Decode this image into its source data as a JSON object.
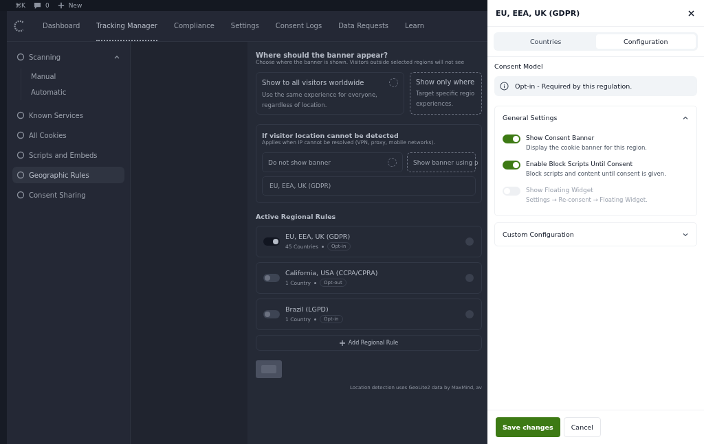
{
  "admin_bar": {
    "shortcut": "⌘K",
    "comments": "0",
    "new_label": "New"
  },
  "nav": {
    "tabs": [
      {
        "label": "Dashboard",
        "selected": false
      },
      {
        "label": "Tracking Manager",
        "selected": true
      },
      {
        "label": "Compliance",
        "selected": false
      },
      {
        "label": "Settings",
        "selected": false
      },
      {
        "label": "Consent Logs",
        "selected": false
      },
      {
        "label": "Data Requests",
        "selected": false
      },
      {
        "label": "Learn",
        "selected": false
      }
    ]
  },
  "sidebar": {
    "items": [
      {
        "label": "Scanning",
        "selected": false,
        "expanded": true,
        "children": [
          {
            "label": "Manual",
            "selected": false
          },
          {
            "label": "Automatic",
            "selected": false
          }
        ]
      },
      {
        "label": "Known Services",
        "selected": false
      },
      {
        "label": "All Cookies",
        "selected": false
      },
      {
        "label": "Scripts and Embeds",
        "selected": false
      },
      {
        "label": "Geographic Rules",
        "selected": true
      },
      {
        "label": "Consent Sharing",
        "selected": false
      }
    ]
  },
  "banner_placement": {
    "title": "Where should the banner appear?",
    "description": "Choose where the banner is shown. Visitors outside selected regions will not see",
    "options": [
      {
        "title": "Show to all visitors worldwide",
        "description": "Use the same experience for everyone, regardless of location.",
        "selected": false
      },
      {
        "title": "Show only where",
        "description": "Target specific regio experiences.",
        "selected": true
      }
    ]
  },
  "fallback": {
    "title": "If visitor location cannot be detected",
    "description": "Applies when IP cannot be resolved (VPN, proxy, mobile networks).",
    "options": [
      {
        "label": "Do not show banner",
        "selected": false
      },
      {
        "label": "Show banner using p",
        "selected": true
      }
    ],
    "region_value": "EU, EEA, UK (GDPR)"
  },
  "regional_rules": {
    "title": "Active Regional Rules",
    "rules": [
      {
        "name": "EU, EEA, UK (GDPR)",
        "count": "45 Countries",
        "model": "Opt-in",
        "on": true
      },
      {
        "name": "California, USA (CCPA/CPRA)",
        "count": "1 Country",
        "model": "Opt-out",
        "on": false
      },
      {
        "name": "Brazil (LGPD)",
        "count": "1 Country",
        "model": "Opt-in",
        "on": false
      }
    ],
    "add_label": "Add Regional Rule",
    "footnote": "Location detection uses GeoLite2 data by MaxMind, av"
  },
  "panel": {
    "title": "EU, EEA, UK (GDPR)",
    "tabs": [
      {
        "label": "Countries",
        "selected": false
      },
      {
        "label": "Configuration",
        "selected": true
      }
    ],
    "consent_model_label": "Consent Model",
    "consent_model_info": "Opt-in - Required by this regulation.",
    "sections": [
      {
        "title": "General Settings",
        "expanded": true,
        "settings": [
          {
            "label": "Show Consent Banner",
            "description": "Display the cookie banner for this region.",
            "on": true,
            "disabled": false
          },
          {
            "label": "Enable Block Scripts Until Consent",
            "description": "Block scripts and content until consent is given.",
            "on": true,
            "disabled": false
          },
          {
            "label": "Show Floating Widget",
            "description": "Settings → Re-consent → Floating Widget.",
            "on": false,
            "disabled": true
          }
        ]
      },
      {
        "title": "Custom Configuration",
        "expanded": false
      }
    ],
    "save_label": "Save changes",
    "cancel_label": "Cancel"
  }
}
